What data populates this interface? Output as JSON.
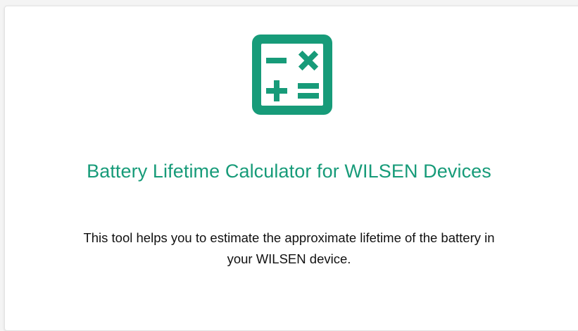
{
  "colors": {
    "accent": "#179b79",
    "text": "#111111",
    "card_background": "#ffffff"
  },
  "hero": {
    "icon": "calculator-icon",
    "title": "Battery Lifetime Calculator for WILSEN Devices",
    "description_line1": "This tool helps you to estimate the approximate lifetime of the battery in",
    "description_line2": "your WILSEN device."
  }
}
